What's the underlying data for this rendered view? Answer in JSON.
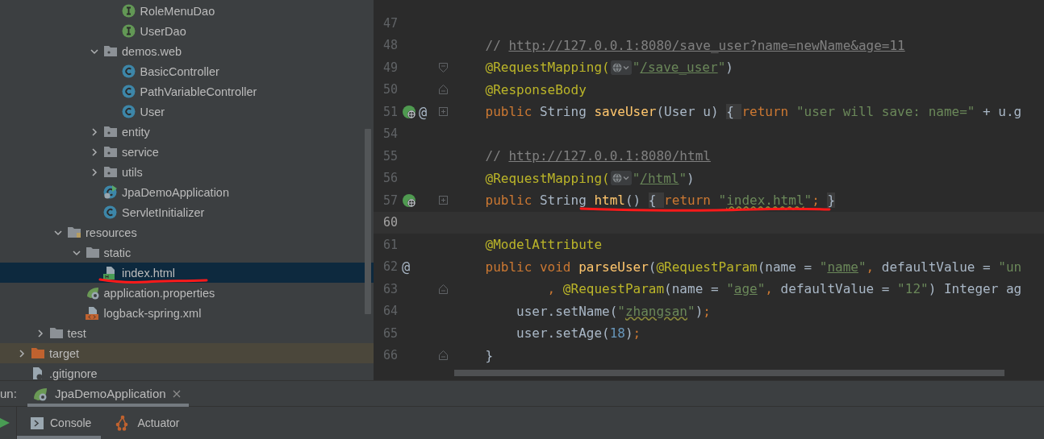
{
  "project_tree": {
    "nodes": [
      {
        "children": [
          {
            "children": [
              {
                "children": [
                  {
                    "children": [
                      {
                        "children": [
                          {
                            "label": "RoleMenuDao",
                            "kind": "interface",
                            "selected": false,
                            "annotated": false
                          },
                          {
                            "label": "UserDao",
                            "kind": "interface",
                            "selected": false,
                            "annotated": false
                          }
                        ]
                      },
                      {
                        "label": "demos.web",
                        "kind": "package",
                        "expanded": true,
                        "selected": false,
                        "annotated": false,
                        "children": [
                          {
                            "label": "BasicController",
                            "kind": "class",
                            "selected": false,
                            "annotated": false
                          },
                          {
                            "label": "PathVariableController",
                            "kind": "class",
                            "selected": false,
                            "annotated": false
                          },
                          {
                            "label": "User",
                            "kind": "class",
                            "selected": false,
                            "annotated": false
                          }
                        ]
                      },
                      {
                        "label": "entity",
                        "kind": "package",
                        "expanded": false,
                        "selected": false,
                        "annotated": false
                      },
                      {
                        "label": "service",
                        "kind": "package",
                        "expanded": false,
                        "selected": false,
                        "annotated": false
                      },
                      {
                        "label": "utils",
                        "kind": "package",
                        "expanded": false,
                        "selected": false,
                        "annotated": false
                      },
                      {
                        "label": "JpaDemoApplication",
                        "kind": "app_class",
                        "selected": false,
                        "annotated": false
                      },
                      {
                        "label": "ServletInitializer",
                        "kind": "class",
                        "selected": false,
                        "annotated": false
                      }
                    ]
                  }
                ]
              },
              {
                "label": "resources",
                "kind": "resources_folder",
                "expanded": true,
                "selected": false,
                "annotated": false,
                "children": [
                  {
                    "label": "static",
                    "kind": "folder",
                    "expanded": true,
                    "selected": false,
                    "annotated": false,
                    "children": [
                      {
                        "label": "index.html",
                        "kind": "html",
                        "selected": true,
                        "annotated": true
                      }
                    ]
                  },
                  {
                    "label": "application.properties",
                    "kind": "properties",
                    "selected": false,
                    "annotated": false
                  },
                  {
                    "label": "logback-spring.xml",
                    "kind": "xml",
                    "selected": false,
                    "annotated": false
                  }
                ]
              }
            ]
          },
          {
            "label": "test",
            "kind": "folder",
            "expanded": false,
            "selected": false,
            "annotated": false
          }
        ]
      },
      {
        "label": "target",
        "kind": "excluded_folder",
        "expanded": false,
        "selected": false,
        "annotated": false
      },
      {
        "label": ".gitignore",
        "kind": "ignore_file",
        "selected": false,
        "annotated": false
      }
    ]
  },
  "editor": {
    "lines": [
      {
        "number": "47",
        "current": false,
        "annotated": false
      },
      {
        "number": "48",
        "current": false,
        "annotated": false,
        "tokens": [
          {
            "kind": "comment",
            "text": "    // "
          },
          {
            "kind": "comment_link",
            "text": "http://127.0.0.1:8080/save_user?name=newName&age=11"
          }
        ]
      },
      {
        "number": "49",
        "current": false,
        "annotated": false,
        "gutter": [
          {
            "kind": "fold_start"
          }
        ],
        "tokens": [
          {
            "kind": "annotation",
            "text": "    @RequestMapping("
          },
          {
            "kind": "url_hint"
          },
          {
            "kind": "string",
            "text": "\""
          },
          {
            "kind": "string_link",
            "text": "/save_user"
          },
          {
            "kind": "string",
            "text": "\""
          },
          {
            "kind": "plain",
            "text": ")"
          }
        ]
      },
      {
        "number": "50",
        "current": false,
        "annotated": false,
        "gutter": [
          {
            "kind": "fold_end"
          }
        ],
        "tokens": [
          {
            "kind": "annotation",
            "text": "    @ResponseBody"
          }
        ]
      },
      {
        "number": "51",
        "current": false,
        "annotated": false,
        "gutter": [
          {
            "kind": "endpoint"
          },
          {
            "kind": "at",
            "text": "@"
          },
          {
            "kind": "fold_collapsed"
          }
        ],
        "tokens": [
          {
            "kind": "keyword",
            "text": "    public "
          },
          {
            "kind": "plain",
            "text": "String "
          },
          {
            "kind": "method",
            "text": "saveUser"
          },
          {
            "kind": "plain",
            "text": "(User u) "
          },
          {
            "kind": "fold",
            "text": "{ "
          },
          {
            "kind": "keyword",
            "text": "return "
          },
          {
            "kind": "string",
            "text": "\"user will save: name=\""
          },
          {
            "kind": "plain",
            "text": " + u.g"
          }
        ]
      },
      {
        "number": "54",
        "current": false,
        "annotated": false
      },
      {
        "number": "55",
        "current": false,
        "annotated": false,
        "tokens": [
          {
            "kind": "comment",
            "text": "    // "
          },
          {
            "kind": "comment_link",
            "text": "http://127.0.0.1:8080/html"
          }
        ]
      },
      {
        "number": "56",
        "current": false,
        "annotated": false,
        "tokens": [
          {
            "kind": "annotation",
            "text": "    @RequestMapping("
          },
          {
            "kind": "url_hint"
          },
          {
            "kind": "string",
            "text": "\""
          },
          {
            "kind": "string_link",
            "text": "/html"
          },
          {
            "kind": "string",
            "text": "\""
          },
          {
            "kind": "plain",
            "text": ")"
          }
        ]
      },
      {
        "number": "57",
        "current": false,
        "annotated": true,
        "gutter": [
          {
            "kind": "endpoint"
          },
          {
            "kind": "fold_collapsed"
          }
        ],
        "tokens": [
          {
            "kind": "keyword",
            "text": "    public "
          },
          {
            "kind": "plain",
            "text": "String "
          },
          {
            "kind": "method",
            "text": "html"
          },
          {
            "kind": "plain",
            "text": "() "
          },
          {
            "kind": "fold",
            "text": "{ "
          },
          {
            "kind": "keyword",
            "text": "return "
          },
          {
            "kind": "string",
            "text": "\""
          },
          {
            "kind": "string_typo",
            "text": "index.html"
          },
          {
            "kind": "string",
            "text": "\""
          },
          {
            "kind": "keyword",
            "text": "; "
          },
          {
            "kind": "fold",
            "text": "}"
          }
        ]
      },
      {
        "number": "60",
        "current": true,
        "annotated": false
      },
      {
        "number": "61",
        "current": false,
        "annotated": false,
        "tokens": [
          {
            "kind": "annotation",
            "text": "    @ModelAttribute"
          }
        ]
      },
      {
        "number": "62",
        "current": false,
        "annotated": false,
        "gutter": [
          {
            "kind": "at",
            "text": "@"
          }
        ],
        "tokens": [
          {
            "kind": "keyword",
            "text": "    public void "
          },
          {
            "kind": "method",
            "text": "parseUser"
          },
          {
            "kind": "plain",
            "text": "("
          },
          {
            "kind": "annotation",
            "text": "@RequestParam"
          },
          {
            "kind": "plain",
            "text": "(name = "
          },
          {
            "kind": "string",
            "text": "\""
          },
          {
            "kind": "string_link",
            "text": "name"
          },
          {
            "kind": "string",
            "text": "\""
          },
          {
            "kind": "keyword",
            "text": ", "
          },
          {
            "kind": "plain",
            "text": "defaultValue = "
          },
          {
            "kind": "string",
            "text": "\"un"
          }
        ]
      },
      {
        "number": "63",
        "current": false,
        "annotated": false,
        "gutter": [
          {
            "kind": "fold_end"
          }
        ],
        "tokens": [
          {
            "kind": "keyword",
            "text": "            , "
          },
          {
            "kind": "annotation",
            "text": "@RequestParam"
          },
          {
            "kind": "plain",
            "text": "(name = "
          },
          {
            "kind": "string",
            "text": "\""
          },
          {
            "kind": "string_link",
            "text": "age"
          },
          {
            "kind": "string",
            "text": "\""
          },
          {
            "kind": "keyword",
            "text": ", "
          },
          {
            "kind": "plain",
            "text": "defaultValue = "
          },
          {
            "kind": "string",
            "text": "\"12\""
          },
          {
            "kind": "plain",
            "text": ") Integer ag"
          }
        ]
      },
      {
        "number": "64",
        "current": false,
        "annotated": false,
        "tokens": [
          {
            "kind": "plain",
            "text": "        user.setName("
          },
          {
            "kind": "string",
            "text": "\""
          },
          {
            "kind": "string_typo",
            "text": "zhangsan"
          },
          {
            "kind": "string",
            "text": "\""
          },
          {
            "kind": "plain",
            "text": ")"
          },
          {
            "kind": "keyword",
            "text": ";"
          }
        ]
      },
      {
        "number": "65",
        "current": false,
        "annotated": false,
        "tokens": [
          {
            "kind": "plain",
            "text": "        user.setAge("
          },
          {
            "kind": "number",
            "text": "18"
          },
          {
            "kind": "plain",
            "text": ")"
          },
          {
            "kind": "keyword",
            "text": ";"
          }
        ]
      },
      {
        "number": "66",
        "current": false,
        "annotated": false,
        "gutter": [
          {
            "kind": "fold_end"
          }
        ],
        "tokens": [
          {
            "kind": "plain",
            "text": "    }"
          }
        ]
      }
    ]
  },
  "run_bar": {
    "label": "un:",
    "tabs": [
      {
        "label": "JpaDemoApplication",
        "selected": true
      }
    ]
  },
  "tool_tabs": [
    {
      "label": "Console",
      "kind": "console",
      "selected": true
    },
    {
      "label": "Actuator",
      "kind": "actuator",
      "selected": false
    }
  ]
}
